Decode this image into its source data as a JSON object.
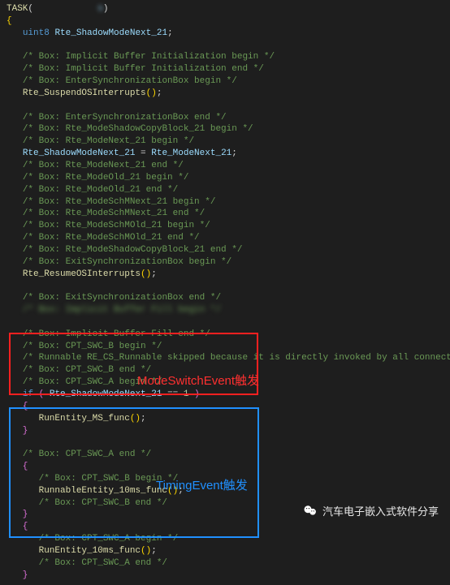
{
  "code": {
    "task_kw": "TASK",
    "task_arg_blur": "            s",
    "decl_type": "uint8",
    "decl_name": "Rte_ShadowModeNext_21",
    "c1": "/* Box: Implicit Buffer Initialization begin */",
    "c2": "/* Box: Implicit Buffer Initialization end */",
    "c3": "/* Box: EnterSynchronizationBox begin */",
    "fn_suspend": "Rte_SuspendOSInterrupts",
    "c4": "/* Box: EnterSynchronizationBox end */",
    "c5": "/* Box: Rte_ModeShadowCopyBlock_21 begin */",
    "c6": "/* Box: Rte_ModeNext_21 begin */",
    "assign_lhs": "Rte_ShadowModeNext_21",
    "assign_rhs": "Rte_ModeNext_21",
    "c7": "/* Box: Rte_ModeNext_21 end */",
    "c8": "/* Box: Rte_ModeOld_21 begin */",
    "c9": "/* Box: Rte_ModeOld_21 end */",
    "c10": "/* Box: Rte_ModeSchMNext_21 begin */",
    "c11": "/* Box: Rte_ModeSchMNext_21 end */",
    "c12": "/* Box: Rte_ModeSchMOld_21 begin */",
    "c13": "/* Box: Rte_ModeSchMOld_21 end */",
    "c14": "/* Box: Rte_ModeShadowCopyBlock_21 end */",
    "c15": "/* Box: ExitSynchronizationBox begin */",
    "fn_resume": "Rte_ResumeOSInterrupts",
    "c16": "/* Box: ExitSynchronizationBox end */",
    "c17_blur": "/* Box: Implicit Buffer Fill begin */",
    "c17b_blur": "                                                          ",
    "c18": "/* Box: Implicit Buffer Fill end */",
    "c19": "/* Box: CPT_SWC_B begin */",
    "c20": "/* Runnable RE_CS_Runnable skipped because it is directly invoked by all connected clients.",
    "c21": "/* Box: CPT_SWC_B end */",
    "c22": "/* Box: CPT_SWC_A begin */",
    "if_kw": "if",
    "if_var": "Rte_ShadowModeNext_21",
    "if_val": "1",
    "fn_ms": "RunEntity_MS_func",
    "c23": "/* Box: CPT_SWC_A end */",
    "c24": "/* Box: CPT_SWC_B begin */",
    "fn_10ms": "RunnableEntity_10ms_func",
    "c25": "/* Box: CPT_SWC_B end */",
    "c26": "/* Box: CPT_SWC_A begin */",
    "fn_10ms2": "RunEntity_10ms_func",
    "c27": "/* Box: CPT_SWC_A end */"
  },
  "annotations": {
    "red": "ModeSwitchEvent触发",
    "blue": "TimingEvent触发"
  },
  "source": {
    "label": "汽车电子嵌入式软件分享"
  }
}
